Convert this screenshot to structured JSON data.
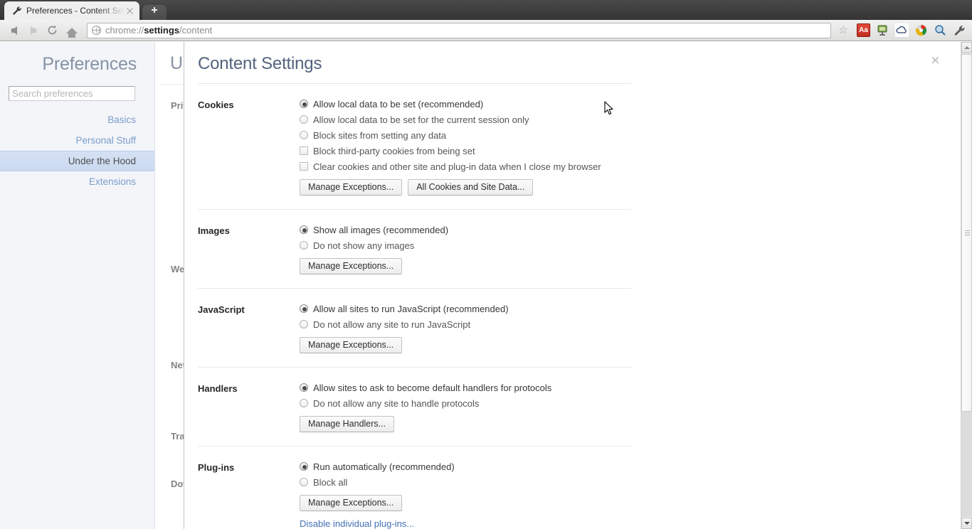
{
  "browser": {
    "tab": {
      "title": "Preferences - Content Set",
      "favicon_name": "wrench-icon",
      "close_label": "×"
    },
    "newtab_label": "+",
    "nav": {
      "back": "Back",
      "forward": "Forward",
      "reload": "Reload",
      "home": "Home"
    },
    "omnibox": {
      "url_prefix": "chrome://",
      "url_bold": "settings",
      "url_suffix": "/content",
      "full_url": "chrome://settings/content",
      "star_label": "☆"
    },
    "extensions": [
      {
        "name": "font-size-extension-icon",
        "label": "Aa"
      },
      {
        "name": "screen-capture-extension-icon",
        "label": ""
      },
      {
        "name": "cloud-extension-icon",
        "label": ""
      },
      {
        "name": "chrome-extension-icon",
        "label": ""
      },
      {
        "name": "zoom-search-extension-icon",
        "label": ""
      },
      {
        "name": "customize-menu-icon",
        "label": ""
      }
    ]
  },
  "sidebar": {
    "brand": "Preferences",
    "search_placeholder": "Search preferences",
    "search_value": "",
    "items": [
      {
        "label": "Basics",
        "active": false
      },
      {
        "label": "Personal Stuff",
        "active": false
      },
      {
        "label": "Under the Hood",
        "active": true
      },
      {
        "label": "Extensions",
        "active": false
      }
    ]
  },
  "background_page": {
    "title": "Under the Hood",
    "sections": [
      "Privacy",
      "Web Content",
      "Network",
      "Translate",
      "Downloads"
    ]
  },
  "dialog": {
    "title": "Content Settings",
    "close_label": "×",
    "sections": [
      {
        "label": "Cookies",
        "options": [
          {
            "type": "radio",
            "checked": true,
            "text": "Allow local data to be set (recommended)"
          },
          {
            "type": "radio",
            "checked": false,
            "text": "Allow local data to be set for the current session only"
          },
          {
            "type": "radio",
            "checked": false,
            "text": "Block sites from setting any data"
          },
          {
            "type": "checkbox",
            "checked": false,
            "text": "Block third-party cookies from being set"
          },
          {
            "type": "checkbox",
            "checked": false,
            "text": "Clear cookies and other site and plug-in data when I close my browser"
          }
        ],
        "buttons": [
          "Manage Exceptions...",
          "All Cookies and Site Data..."
        ],
        "link": null
      },
      {
        "label": "Images",
        "options": [
          {
            "type": "radio",
            "checked": true,
            "text": "Show all images (recommended)"
          },
          {
            "type": "radio",
            "checked": false,
            "text": "Do not show any images"
          }
        ],
        "buttons": [
          "Manage Exceptions..."
        ],
        "link": null
      },
      {
        "label": "JavaScript",
        "options": [
          {
            "type": "radio",
            "checked": true,
            "text": "Allow all sites to run JavaScript (recommended)"
          },
          {
            "type": "radio",
            "checked": false,
            "text": "Do not allow any site to run JavaScript"
          }
        ],
        "buttons": [
          "Manage Exceptions..."
        ],
        "link": null
      },
      {
        "label": "Handlers",
        "options": [
          {
            "type": "radio",
            "checked": true,
            "text": "Allow sites to ask to become default handlers for protocols"
          },
          {
            "type": "radio",
            "checked": false,
            "text": "Do not allow any site to handle protocols"
          }
        ],
        "buttons": [
          "Manage Handlers..."
        ],
        "link": null
      },
      {
        "label": "Plug-ins",
        "options": [
          {
            "type": "radio",
            "checked": true,
            "text": "Run automatically (recommended)"
          },
          {
            "type": "radio",
            "checked": false,
            "text": "Block all"
          }
        ],
        "buttons": [
          "Manage Exceptions..."
        ],
        "link": "Disable individual plug-ins..."
      }
    ]
  },
  "colors": {
    "accent_link": "#4471b5",
    "title": "#53637d",
    "sidebar_bg": "#eef1f6",
    "active_nav": "#b5caea"
  }
}
